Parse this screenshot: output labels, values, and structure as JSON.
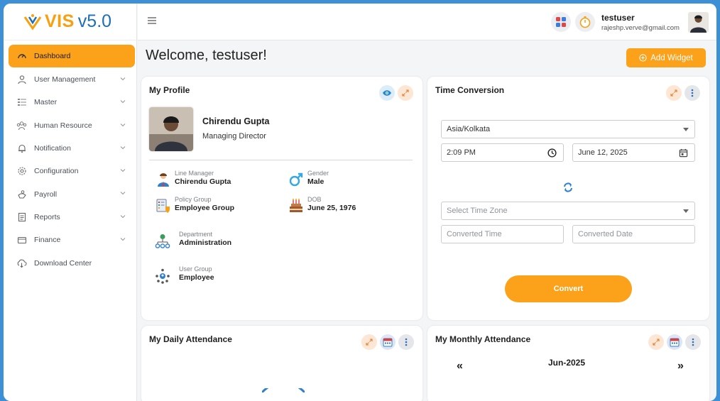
{
  "brand": {
    "name": "VIS",
    "version": "v5.0",
    "accent": "#fba21a",
    "blue": "#1f6fb5"
  },
  "sidebar": {
    "items": [
      {
        "label": "Dashboard",
        "icon": "gauge-icon",
        "active": true
      },
      {
        "label": "User Management",
        "icon": "user-icon"
      },
      {
        "label": "Master",
        "icon": "list-icon"
      },
      {
        "label": "Human Resource",
        "icon": "people-icon"
      },
      {
        "label": "Notification",
        "icon": "bell-icon"
      },
      {
        "label": "Configuration",
        "icon": "gear-icon"
      },
      {
        "label": "Payroll",
        "icon": "payroll-icon"
      },
      {
        "label": "Reports",
        "icon": "report-icon"
      },
      {
        "label": "Finance",
        "icon": "finance-icon"
      },
      {
        "label": "Download Center",
        "icon": "cloud-download-icon"
      }
    ]
  },
  "header": {
    "user_name": "testuser",
    "user_email": "rajeshp.verve@gmail.com"
  },
  "page": {
    "welcome": "Welcome, testuser!",
    "add_widget": "Add Widget"
  },
  "profile": {
    "title": "My Profile",
    "name": "Chirendu Gupta",
    "role": "Managing Director",
    "fields": {
      "line_manager_label": "Line Manager",
      "line_manager": "Chirendu Gupta",
      "gender_label": "Gender",
      "gender": "Male",
      "policy_group_label": "Policy Group",
      "policy_group": "Employee Group",
      "dob_label": "DOB",
      "dob": "June 25, 1976",
      "department_label": "Department",
      "department": "Administration",
      "user_group_label": "User Group",
      "user_group": "Employee"
    }
  },
  "time_conversion": {
    "title": "Time Conversion",
    "timezone": "Asia/Kolkata",
    "time": "2:09 PM",
    "date": "June 12, 2025",
    "select_placeholder": "Select Time Zone",
    "converted_time_placeholder": "Converted Time",
    "converted_date_placeholder": "Converted Date",
    "convert_label": "Convert"
  },
  "daily_attendance": {
    "title": "My Daily Attendance"
  },
  "monthly_attendance": {
    "title": "My Monthly Attendance",
    "month": "Jun-2025",
    "prev": "«",
    "next": "»"
  }
}
